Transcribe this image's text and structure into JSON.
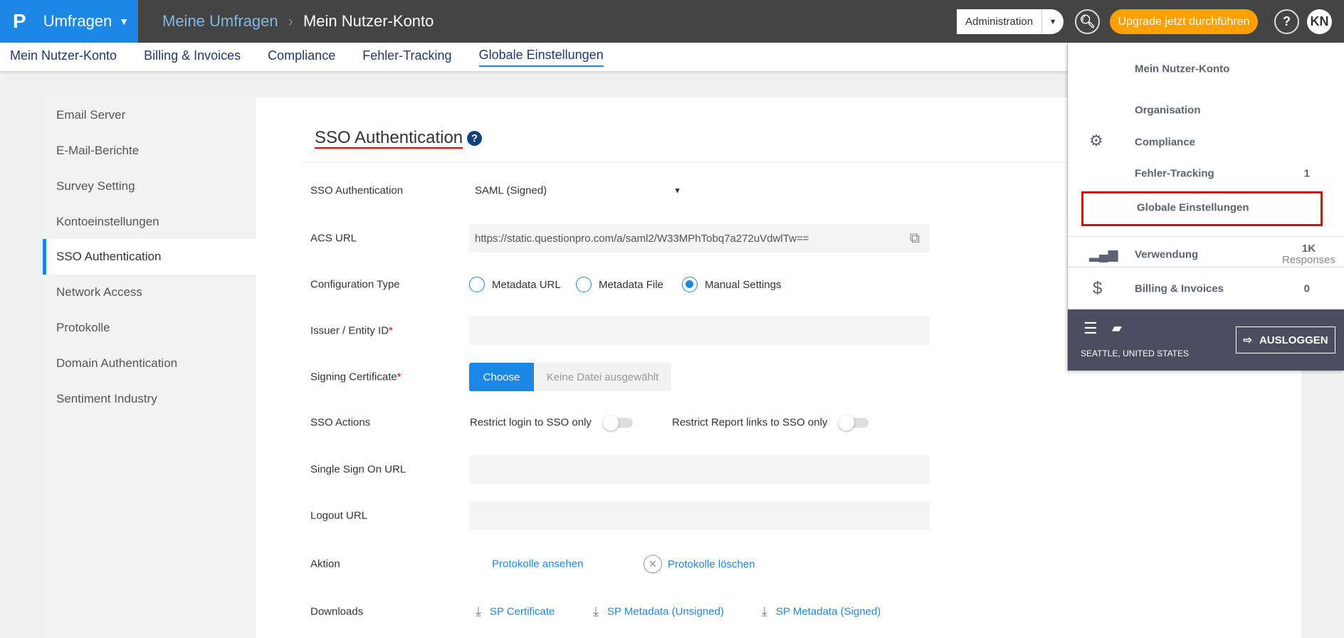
{
  "topbar": {
    "logo": "P",
    "app": "Umfragen",
    "breadcrumb": [
      "Meine Umfragen",
      "Mein Nutzer-Konto"
    ],
    "admin": "Administration",
    "upgrade": "Upgrade jetzt durchführen",
    "help": "?",
    "avatar": "KN"
  },
  "subnav": [
    "Mein Nutzer-Konto",
    "Billing & Invoices",
    "Compliance",
    "Fehler-Tracking",
    "Globale Einstellungen"
  ],
  "sidebar": [
    "Email Server",
    "E-Mail-Berichte",
    "Survey Setting",
    "Kontoeinstellungen",
    "SSO Authentication",
    "Network Access",
    "Protokolle",
    "Domain Authentication",
    "Sentiment Industry"
  ],
  "main": {
    "title": "SSO Authentication",
    "help": "?",
    "labels": {
      "sso": "SSO Authentication",
      "acs": "ACS URL",
      "config": "Configuration Type",
      "issuer": "Issuer / Entity ID",
      "signing": "Signing Certificate",
      "actions": "SSO Actions",
      "ssourl": "Single Sign On URL",
      "logout": "Logout URL",
      "aktion": "Aktion",
      "downloads": "Downloads"
    },
    "required": "*",
    "sso_value": "SAML (Signed)",
    "acs_url": "https://static.questionpro.com/a/saml2/W33MPhTobq7a272uVdwlTw==",
    "config_options": [
      "Metadata URL",
      "Metadata File",
      "Manual Settings"
    ],
    "choose": "Choose",
    "no_file": "Keine Datei ausgewählt",
    "toggles": [
      "Restrict login to SSO only",
      "Restrict Report links to SSO only"
    ],
    "aktion_links": [
      "Protokolle ansehen",
      "Protokolle löschen"
    ],
    "downloads": [
      "SP Certificate",
      "SP Metadata (Unsigned)",
      "SP Metadata (Signed)"
    ]
  },
  "menu": {
    "items": [
      "Mein Nutzer-Konto",
      "Organisation",
      "Compliance",
      "Fehler-Tracking",
      "Globale Einstellungen"
    ],
    "fehler_count": "1",
    "usage": "Verwendung",
    "usage_value": "1K",
    "usage_unit": "Responses",
    "billing": "Billing & Invoices",
    "billing_value": "0",
    "location": "SEATTLE, UNITED STATES",
    "logout": "AUSLOGGEN"
  },
  "colors": {
    "brand": "#1b87e6",
    "upgrade": "#ffa000",
    "highlight": "#e00000"
  }
}
